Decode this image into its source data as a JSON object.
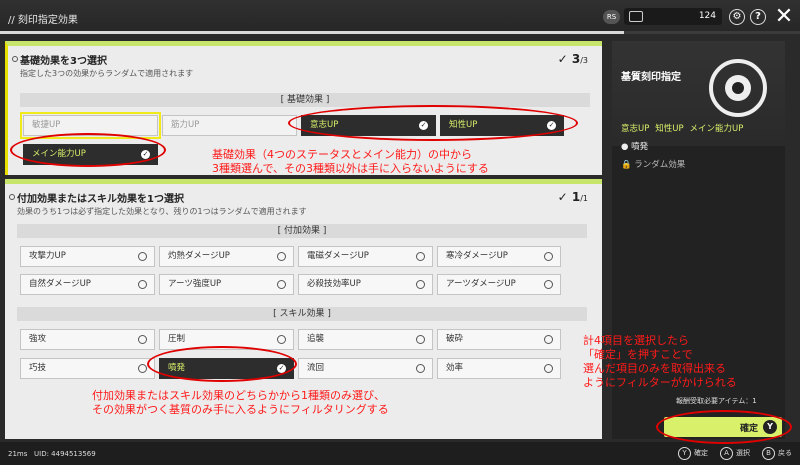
{
  "topbar": {
    "title": "// 刻印指定効果",
    "rs_label": "RS",
    "currency_value": "124",
    "help_label": "?",
    "progress_fraction": 0.78
  },
  "basic": {
    "title": "基礎効果を3つ選択",
    "subtitle": "指定した3つの効果からランダムで適用されます",
    "count": "3",
    "count_total": "/3",
    "section_label": "[ 基礎効果 ]",
    "options": [
      {
        "label": "敏捷UP",
        "state": "disabled"
      },
      {
        "label": "筋力UP",
        "state": "disabled"
      },
      {
        "label": "意志UP",
        "state": "selected"
      },
      {
        "label": "知性UP",
        "state": "selected"
      },
      {
        "label": "メイン能力UP",
        "state": "selected"
      }
    ]
  },
  "extra": {
    "title": "付加効果またはスキル効果を1つ選択",
    "subtitle": "効果のうち1つは必ず指定した効果となり、残りの1つはランダムで適用されます",
    "count": "1",
    "count_total": "/1",
    "extra_section_label": "[ 付加効果 ]",
    "extra_options": [
      "攻撃力UP",
      "灼熱ダメージUP",
      "電磁ダメージUP",
      "寒冷ダメージUP",
      "自然ダメージUP",
      "アーツ強度UP",
      "必殺技効率UP",
      "アーツダメージUP"
    ],
    "skill_section_label": "[ スキル効果 ]",
    "skill_options": [
      {
        "label": "強攻",
        "state": "normal"
      },
      {
        "label": "圧制",
        "state": "normal"
      },
      {
        "label": "追襲",
        "state": "normal"
      },
      {
        "label": "破砕",
        "state": "normal"
      },
      {
        "label": "巧技",
        "state": "normal"
      },
      {
        "label": "噴発",
        "state": "selected"
      },
      {
        "label": "流回",
        "state": "normal"
      },
      {
        "label": "効率",
        "state": "normal"
      }
    ]
  },
  "sidebar": {
    "item_name": "基質刻印指定",
    "chips": [
      "意志UP",
      "知性UP",
      "メイン能力UP"
    ],
    "skill": "● 噴発",
    "random": "🔒 ランダム効果",
    "required": "報酬受取必要アイテム：1",
    "confirm_label": "確定",
    "confirm_key": "Y"
  },
  "bottom": {
    "ms": "21ms",
    "uid": "UID: 4494513569",
    "hints": [
      {
        "key": "Y",
        "label": "確定"
      },
      {
        "key": "A",
        "label": "選択"
      },
      {
        "key": "B",
        "label": "戻る"
      }
    ]
  },
  "annotations": {
    "basic_note_1": "基礎効果（4つのステータスとメイン能力）の中から",
    "basic_note_2": "3種類選んで、その3種類以外は手に入らないようにする",
    "extra_note_1": "付加効果またはスキル効果のどちらかから1種類のみ選び、",
    "extra_note_2": "その効果がつく基質のみ手に入るようにフィルタリングする",
    "confirm_note_1": "計4項目を選択したら",
    "confirm_note_2": "「確定」を押すことで",
    "confirm_note_3": "選んだ項目のみを取得出来る",
    "confirm_note_4": "ようにフィルターがかけられる"
  }
}
